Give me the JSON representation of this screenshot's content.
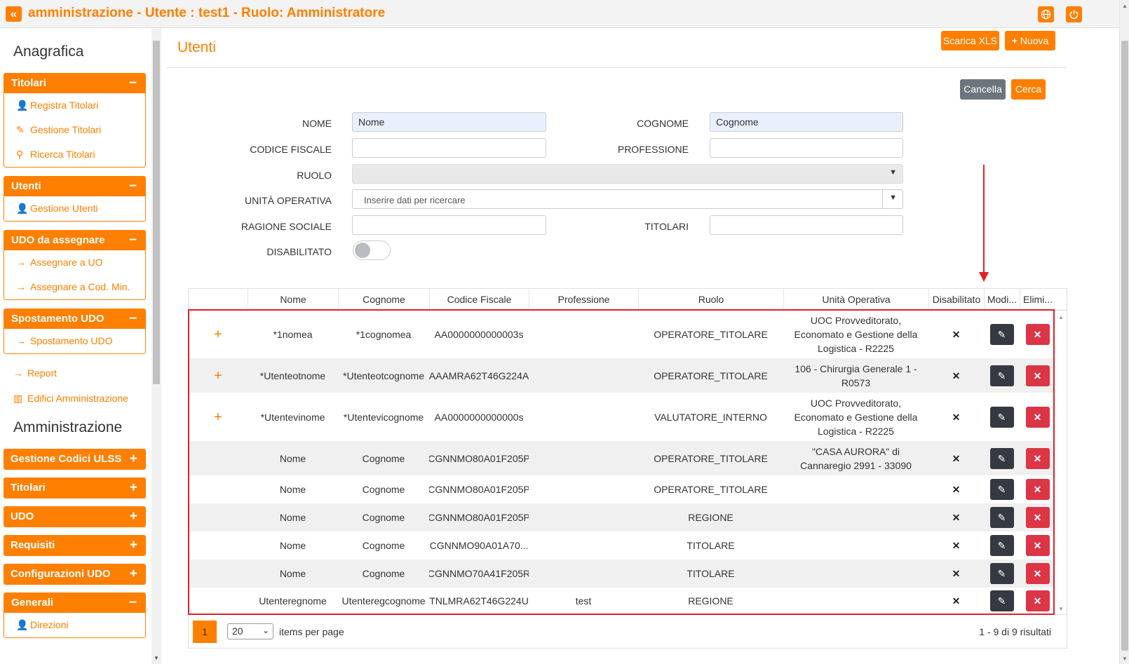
{
  "header": {
    "collapse_icon": "double-chevron-left-icon",
    "title": "amministrazione - Utente : test1 - Ruolo: Amministratore",
    "globe_icon": "globe-icon",
    "power_icon": "power-icon"
  },
  "sidebar": {
    "section1": "Anagrafica",
    "group_titolari": {
      "label": "Titolari",
      "toggle": "−",
      "items": [
        "Registra Titolari",
        "Gestione Titolari",
        "Ricerca Titolari"
      ]
    },
    "group_utenti": {
      "label": "Utenti",
      "toggle": "−",
      "items": [
        "Gestione Utenti"
      ]
    },
    "group_udo": {
      "label": "UDO da assegnare",
      "toggle": "−",
      "items": [
        "Assegnare a UO",
        "Assegnare a Cod. Min."
      ]
    },
    "group_spost": {
      "label": "Spostamento UDO",
      "toggle": "−",
      "items": [
        "Spostamento UDO"
      ]
    },
    "link_report": "Report",
    "link_edifici": "Edifici Amministrazione",
    "section2": "Amministrazione",
    "blocks": [
      {
        "label": "Gestione Codici ULSS",
        "toggle": "+"
      },
      {
        "label": "Titolari",
        "toggle": "+"
      },
      {
        "label": "UDO",
        "toggle": "+"
      },
      {
        "label": "Requisiti",
        "toggle": "+"
      },
      {
        "label": "Configurazioni UDO",
        "toggle": "+"
      }
    ],
    "group_generali": {
      "label": "Generali",
      "toggle": "−",
      "items": [
        "Direzioni"
      ]
    }
  },
  "main": {
    "title": "Utenti",
    "btn_xls": "Scarica XLS",
    "btn_nuova": "Nuova",
    "btn_cancella": "Cancella",
    "btn_cerca": "Cerca",
    "form": {
      "nome_label": "NOME",
      "nome_value": "Nome",
      "cognome_label": "COGNOME",
      "cognome_value": "Cognome",
      "cf_label": "CODICE FISCALE",
      "cf_value": "",
      "professione_label": "PROFESSIONE",
      "professione_value": "",
      "ruolo_label": "RUOLO",
      "uo_label": "UNITÀ OPERATIVA",
      "uo_placeholder": "Inserire dati per ricercare",
      "ragione_label": "RAGIONE SOCIALE",
      "ragione_value": "",
      "titolari_label": "TITOLARI",
      "titolari_value": "",
      "disabilitato_label": "DISABILITATO",
      "disabilitato_on": false
    },
    "table": {
      "headers": [
        "",
        "Nome",
        "Cognome",
        "Codice Fiscale",
        "Professione",
        "Ruolo",
        "Unità Operativa",
        "Disabilitato",
        "Modi...",
        "Elimi..."
      ],
      "rows": [
        {
          "expand": "+",
          "nome": "*1nomea",
          "cognome": "*1cognomea",
          "cf": "AA0000000000003s",
          "prof": "",
          "ruolo": "OPERATORE_TITOLARE",
          "uo": "UOC Provveditorato, Economato e Gestione della Logistica - R2225",
          "dis": "✕"
        },
        {
          "expand": "+",
          "nome": "*Utenteotnome",
          "cognome": "*Utenteotcognome",
          "cf": "AAAMRA62T46G224A",
          "prof": "",
          "ruolo": "OPERATORE_TITOLARE",
          "uo": "106 - Chirurgia Generale 1 - R0573",
          "dis": "✕"
        },
        {
          "expand": "+",
          "nome": "*Utentevinome",
          "cognome": "*Utentevicognome",
          "cf": "AA0000000000000s",
          "prof": "",
          "ruolo": "VALUTATORE_INTERNO",
          "uo": "UOC Provveditorato, Economato e Gestione della Logistica - R2225",
          "dis": "✕"
        },
        {
          "expand": "",
          "nome": "Nome",
          "cognome": "Cognome",
          "cf": "CGNNMO80A01F205P",
          "prof": "",
          "ruolo": "OPERATORE_TITOLARE",
          "uo": "\"CASA AURORA\" di Cannaregio 2991 - 33090",
          "dis": "✕"
        },
        {
          "expand": "",
          "nome": "Nome",
          "cognome": "Cognome",
          "cf": "CGNNMO80A01F205P",
          "prof": "",
          "ruolo": "OPERATORE_TITOLARE",
          "uo": "",
          "dis": "✕"
        },
        {
          "expand": "",
          "nome": "Nome",
          "cognome": "Cognome",
          "cf": "CGNNMO80A01F205P",
          "prof": "",
          "ruolo": "REGIONE",
          "uo": "",
          "dis": "✕"
        },
        {
          "expand": "",
          "nome": "Nome",
          "cognome": "Cognome",
          "cf": "CGNNMO90A01A70...",
          "prof": "",
          "ruolo": "TITOLARE",
          "uo": "",
          "dis": "✕"
        },
        {
          "expand": "",
          "nome": "Nome",
          "cognome": "Cognome",
          "cf": "CGNNMO70A41F205R",
          "prof": "",
          "ruolo": "TITOLARE",
          "uo": "",
          "dis": "✕"
        },
        {
          "expand": "",
          "nome": "Utenteregnome",
          "cognome": "Utenteregcognome",
          "cf": "TNLMRA62T46G224U",
          "prof": "test",
          "ruolo": "REGIONE",
          "uo": "",
          "dis": "✕"
        }
      ]
    },
    "pager": {
      "page": "1",
      "per_page": "20",
      "per_page_label": "items per page",
      "results": "1 - 9 di 9 risultati"
    }
  },
  "colors": {
    "accent": "#ff7f00",
    "edit": "#343a40",
    "delete": "#dc3545",
    "annotation": "#e0202a"
  }
}
